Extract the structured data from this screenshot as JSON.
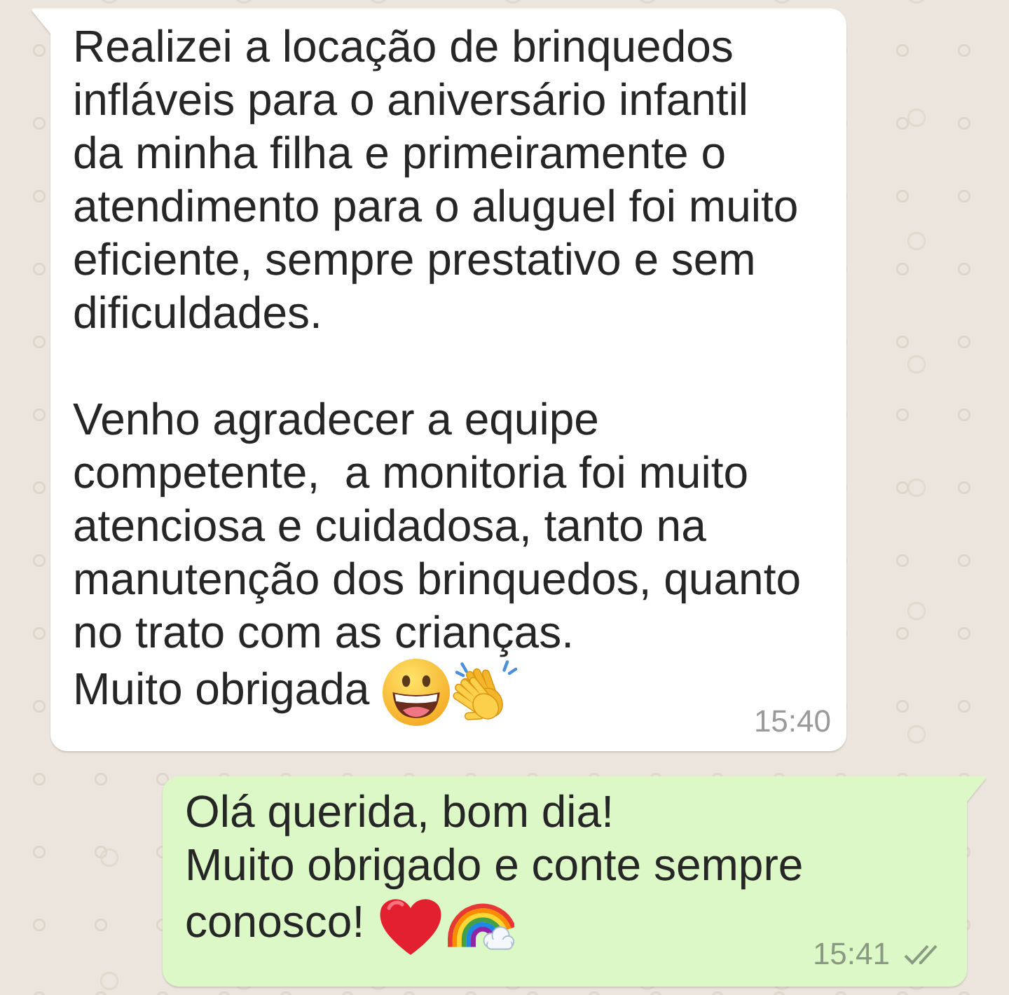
{
  "messages": [
    {
      "outgoing": false,
      "paragraphs": [
        [
          "Realizei a locação de brinquedos infláveis para o aniversário infantil da minha filha e primeiramente o atendimento para o aluguel foi muito eficiente, sempre prestativo e sem dificuldades."
        ],
        [
          "Venho agradecer a equipe competente,  a monitoria foi muito atenciosa e cuidadosa, tanto na manutenção dos brinquedos, quanto no trato com as crianças.",
          "Muito obrigada"
        ]
      ],
      "emojis": [
        {
          "kind": "grinning-face"
        },
        {
          "kind": "clapping-hands"
        }
      ],
      "time": "15:40"
    },
    {
      "outgoing": true,
      "paragraphs": [
        [
          "Olá querida, bom dia!",
          "Muito obrigado e conte sempre",
          "conosco!"
        ]
      ],
      "emojis": [
        {
          "kind": "heart"
        },
        {
          "kind": "rainbow"
        }
      ],
      "time": "15:41",
      "delivered": true,
      "read": false
    }
  ]
}
